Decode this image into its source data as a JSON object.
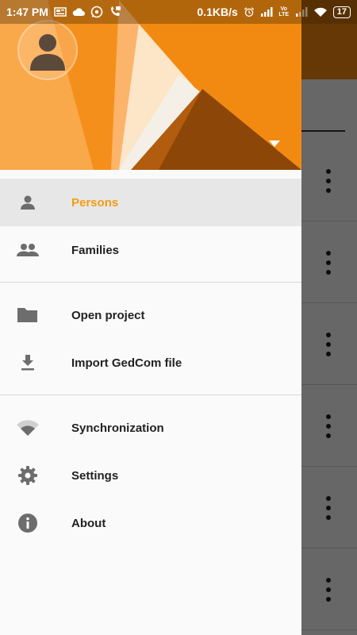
{
  "status_bar": {
    "time": "1:47 PM",
    "speed": "0.1KB/s",
    "battery": "17",
    "volte": "Vo LTE"
  },
  "drawer": {
    "header": {
      "avatar_icon": "person-avatar-icon",
      "dropdown_icon": "caret-down-icon"
    },
    "menu": {
      "group1": [
        {
          "label": "Persons",
          "icon": "person-icon",
          "active": true
        },
        {
          "label": "Families",
          "icon": "people-icon",
          "active": false
        }
      ],
      "group2": [
        {
          "label": "Open project",
          "icon": "folder-icon"
        },
        {
          "label": "Import GedCom file",
          "icon": "download-icon"
        }
      ],
      "group3": [
        {
          "label": "Synchronization",
          "icon": "wifi-icon"
        },
        {
          "label": "Settings",
          "icon": "gear-icon"
        },
        {
          "label": "About",
          "icon": "info-icon"
        }
      ]
    }
  },
  "colors": {
    "accent": "#f39c12",
    "header_orange": "#f7931e",
    "icon_gray": "#6d6d6d"
  }
}
